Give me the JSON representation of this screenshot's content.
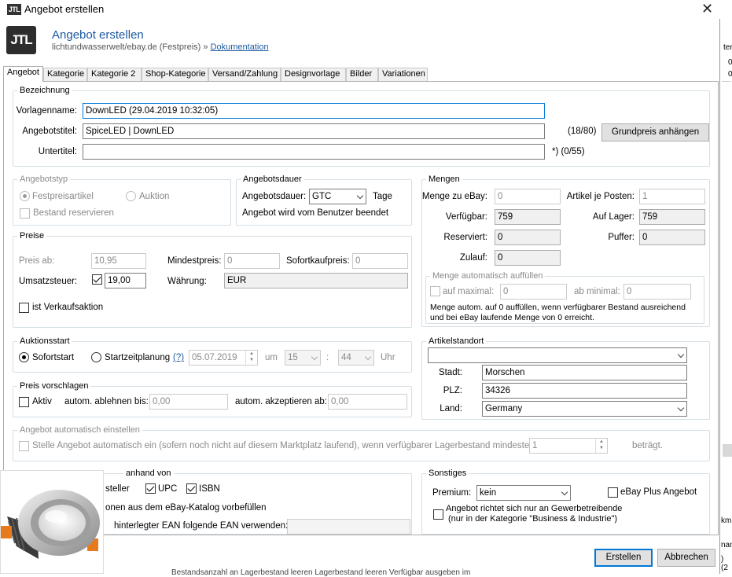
{
  "window": {
    "title": "Angebot erstellen",
    "logo": "JTL"
  },
  "header": {
    "title": "Angebot erstellen",
    "subtitle": "lichtundwasserwelt/ebay.de (Festpreis)",
    "separator": "»",
    "doc_link": "Dokumentation"
  },
  "tabs": [
    "Angebot",
    "Kategorie",
    "Kategorie 2",
    "Shop-Kategorie",
    "Versand/Zahlung",
    "Designvorlage",
    "Bilder",
    "Variationen"
  ],
  "bezeichnung": {
    "legend": "Bezeichnung",
    "vorlagenname_label": "Vorlagenname:",
    "vorlagenname_value": "DownLED  (29.04.2019 10:32:05)",
    "angebotstitel_label": "Angebotstitel:",
    "angebotstitel_value": "SpiceLED | DownLED",
    "angebotstitel_count": "(18/80)",
    "untertitel_label": "Untertitel:",
    "untertitel_value": "",
    "untertitel_count": "*)   (0/55)",
    "grundpreis_button": "Grundpreis anhängen"
  },
  "angebotstyp": {
    "legend": "Angebotstyp",
    "festpreis": "Festpreisartikel",
    "auktion": "Auktion",
    "bestand": "Bestand reservieren"
  },
  "angebotsdauer": {
    "legend": "Angebotsdauer",
    "label": "Angebotsdauer:",
    "value": "GTC",
    "unit": "Tage",
    "note": "Angebot wird vom Benutzer beendet"
  },
  "mengen": {
    "legend": "Mengen",
    "menge_ebay_label": "Menge zu eBay:",
    "menge_ebay_value": "0",
    "artikel_posten_label": "Artikel je Posten:",
    "artikel_posten_value": "1",
    "verfuegbar_label": "Verfügbar:",
    "verfuegbar_value": "759",
    "auf_lager_label": "Auf Lager:",
    "auf_lager_value": "759",
    "reserviert_label": "Reserviert:",
    "reserviert_value": "0",
    "puffer_label": "Puffer:",
    "puffer_value": "0",
    "zulauf_label": "Zulauf:",
    "zulauf_value": "0",
    "auto_legend": "Menge automatisch auffüllen",
    "auf_maximal_label": "auf maximal:",
    "auf_maximal_value": "0",
    "ab_minimal_label": "ab minimal:",
    "ab_minimal_value": "0",
    "auto_note_1": "Menge autom. auf 0 auffüllen, wenn verfügbarer Bestand ausreichend",
    "auto_note_2": "und bei eBay laufende Menge von 0 erreicht."
  },
  "preise": {
    "legend": "Preise",
    "preis_ab_label": "Preis ab:",
    "preis_ab_value": "10,95",
    "mindestpreis_label": "Mindestpreis:",
    "mindestpreis_value": "0",
    "sofortkauf_label": "Sofortkaufpreis:",
    "sofortkauf_value": "0",
    "ust_label": "Umsatzsteuer:",
    "ust_value": "19,00",
    "waehrung_label": "Währung:",
    "waehrung_value": "EUR",
    "verkaufsaktion": "ist Verkaufsaktion"
  },
  "auktionsstart": {
    "legend": "Auktionsstart",
    "sofortstart": "Sofortstart",
    "startzeitplanung": "Startzeitplanung",
    "help": "(?)",
    "datum": "05.07.2019",
    "um": "um",
    "stunde": "15",
    "doppelpunkt": ":",
    "minute": "44",
    "uhr": "Uhr"
  },
  "artikelstandort": {
    "legend": "Artikelstandort",
    "combo_value": "",
    "stadt_label": "Stadt:",
    "stadt_value": "Morschen",
    "plz_label": "PLZ:",
    "plz_value": "34326",
    "land_label": "Land:",
    "land_value": "Germany"
  },
  "preis_vorschlagen": {
    "legend": "Preis vorschlagen",
    "aktiv": "Aktiv",
    "ablehnen_label": "autom. ablehnen bis:",
    "ablehnen_value": "0,00",
    "akzeptieren_label": "autom. akzeptieren ab:",
    "akzeptieren_value": "0,00"
  },
  "auto_einstellen": {
    "legend": "Angebot automatisch einstellen",
    "text": "Stelle Angebot automatisch ein (sofern noch nicht auf diesem Marktplatz laufend), wenn verfügbarer Lagerbestand mindestens",
    "value": "1",
    "suffix": "beträgt."
  },
  "produkt": {
    "legend_visible": "anhand von",
    "hersteller": "steller",
    "upc": "UPC",
    "isbn": "ISBN",
    "katalog": "onen aus dem eBay-Katalog vorbefüllen",
    "ean": "hinterlegter EAN folgende EAN verwenden:"
  },
  "sonstiges": {
    "legend": "Sonstiges",
    "premium_label": "Premium:",
    "premium_value": "kein",
    "ebay_plus": "eBay Plus Angebot",
    "gewerbe_1": "Angebot richtet sich nur an Gewerbetreibende",
    "gewerbe_2": "(nur in der Kategorie \"Business & Industrie\")"
  },
  "buttons": {
    "erstellen": "Erstellen",
    "abbrechen": "Abbrechen"
  },
  "right_strip": {
    "t1": "ter",
    "t2": "0",
    "t3": "0",
    "t4": "km",
    "t5": "nan",
    "t6": ") (2"
  },
  "footer_text": "Bestandsanzahl an    Lagerbestand leeren    Lagerbestand leeren    Verfügbar ausgeben    im"
}
